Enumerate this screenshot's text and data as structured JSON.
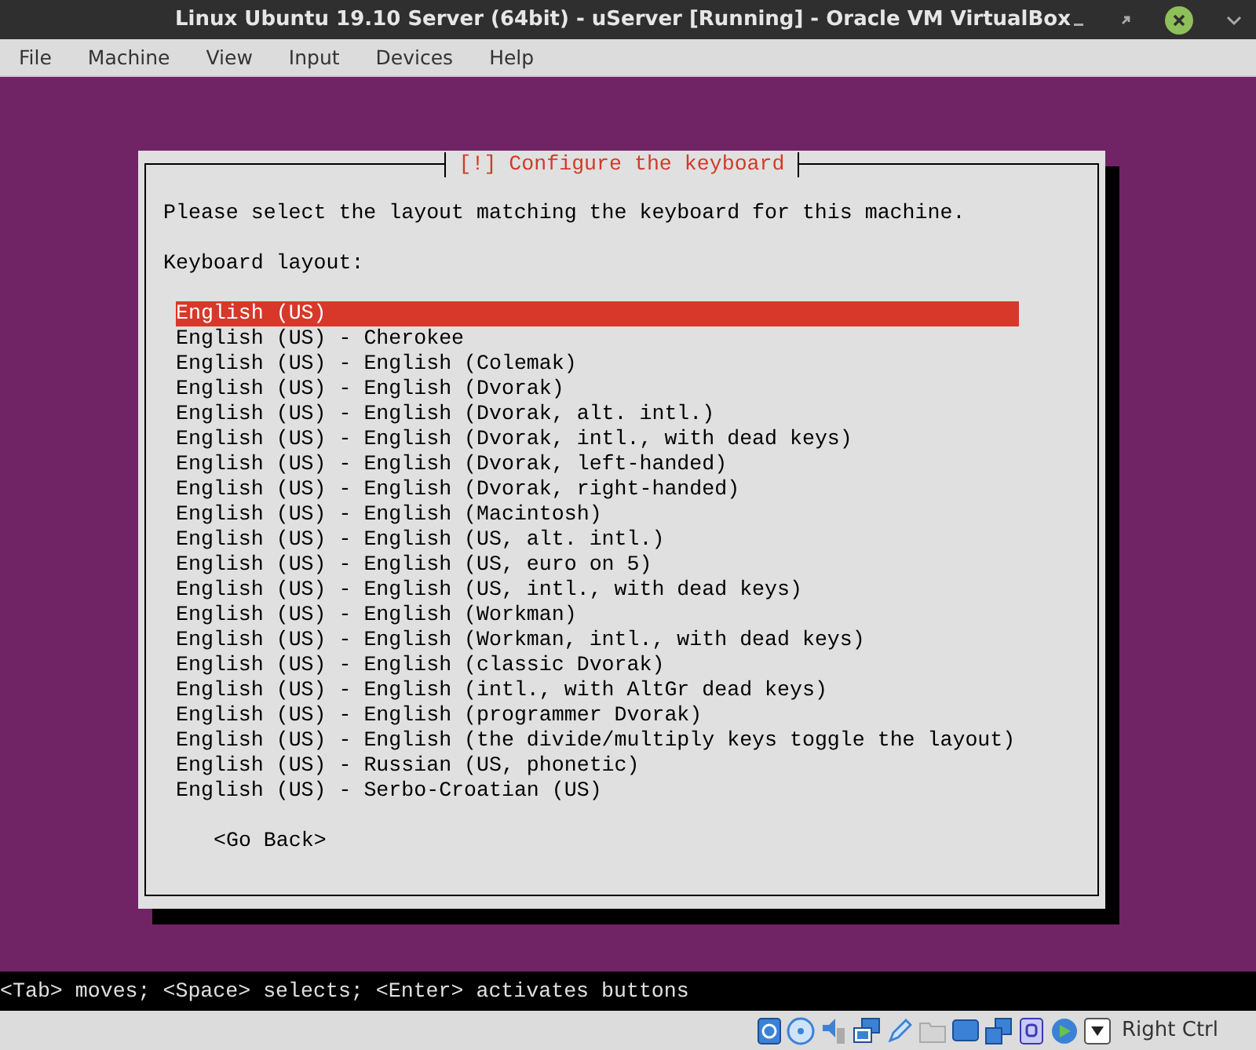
{
  "window": {
    "title": "Linux Ubuntu 19.10 Server (64bit) - uServer [Running] - Oracle VM VirtualBox"
  },
  "menu": [
    "File",
    "Machine",
    "View",
    "Input",
    "Devices",
    "Help"
  ],
  "dialog": {
    "title": "[!] Configure the keyboard",
    "prompt": "Please select the layout matching the keyboard for this machine.",
    "list_label": "Keyboard layout:",
    "options": [
      {
        "label": "English (US)",
        "selected": true
      },
      {
        "label": "English (US) - Cherokee",
        "selected": false
      },
      {
        "label": "English (US) - English (Colemak)",
        "selected": false
      },
      {
        "label": "English (US) - English (Dvorak)",
        "selected": false
      },
      {
        "label": "English (US) - English (Dvorak, alt. intl.)",
        "selected": false
      },
      {
        "label": "English (US) - English (Dvorak, intl., with dead keys)",
        "selected": false
      },
      {
        "label": "English (US) - English (Dvorak, left-handed)",
        "selected": false
      },
      {
        "label": "English (US) - English (Dvorak, right-handed)",
        "selected": false
      },
      {
        "label": "English (US) - English (Macintosh)",
        "selected": false
      },
      {
        "label": "English (US) - English (US, alt. intl.)",
        "selected": false
      },
      {
        "label": "English (US) - English (US, euro on 5)",
        "selected": false
      },
      {
        "label": "English (US) - English (US, intl., with dead keys)",
        "selected": false
      },
      {
        "label": "English (US) - English (Workman)",
        "selected": false
      },
      {
        "label": "English (US) - English (Workman, intl., with dead keys)",
        "selected": false
      },
      {
        "label": "English (US) - English (classic Dvorak)",
        "selected": false
      },
      {
        "label": "English (US) - English (intl., with AltGr dead keys)",
        "selected": false
      },
      {
        "label": "English (US) - English (programmer Dvorak)",
        "selected": false
      },
      {
        "label": "English (US) - English (the divide/multiply keys toggle the layout)",
        "selected": false
      },
      {
        "label": "English (US) - Russian (US, phonetic)",
        "selected": false
      },
      {
        "label": "English (US) - Serbo-Croatian (US)",
        "selected": false
      }
    ],
    "back_button": "<Go Back>"
  },
  "console_hint": "<Tab> moves; <Space> selects; <Enter> activates buttons",
  "status_bar": {
    "host_key": "Right Ctrl"
  }
}
